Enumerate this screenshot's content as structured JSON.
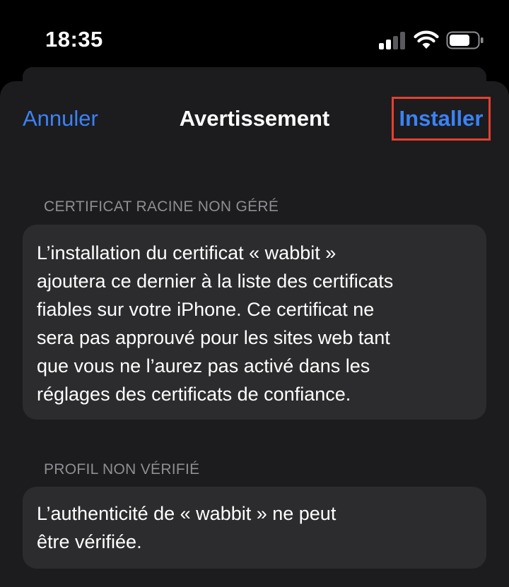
{
  "status_bar": {
    "time": "18:35",
    "icons": [
      "cellular-signal-icon",
      "wifi-icon",
      "battery-icon"
    ]
  },
  "nav": {
    "cancel_label": "Annuler",
    "title": "Avertissement",
    "install_label": "Installer"
  },
  "sections": [
    {
      "header": "CERTIFICAT RACINE NON GÉRÉ",
      "body": "L’installation du certificat « wabbit »\najoutera ce dernier à la liste des certificats\nfiables sur votre iPhone. Ce certificat ne\nsera pas approuvé pour les sites web tant\nque vous ne l’aurez pas activé dans les\nréglages des certificats de confiance."
    },
    {
      "header": "PROFIL NON VÉRIFIÉ",
      "body": "L’authenticité de « wabbit » ne peut\nêtre vérifiée."
    }
  ],
  "colors": {
    "accent": "#3b82f6",
    "highlight_border": "#e4402f",
    "sheet_background": "#1c1c1e",
    "group_background": "#2c2c2e",
    "section_header": "#8e8e93"
  }
}
